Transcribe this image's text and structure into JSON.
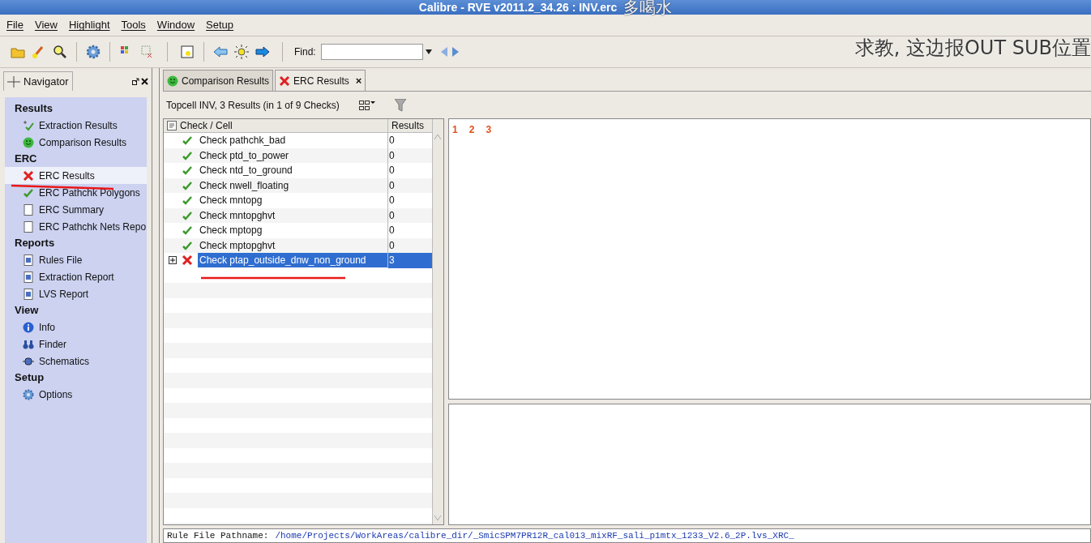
{
  "window": {
    "title": "Calibre - RVE v2011.2_34.26 : INV.erc"
  },
  "menu": [
    "File",
    "View",
    "Highlight",
    "Tools",
    "Window",
    "Setup"
  ],
  "toolbar": {
    "find_label": "Find:"
  },
  "navigator": {
    "tab": "Navigator",
    "sections": [
      {
        "title": "Results",
        "items": [
          {
            "label": "Extraction Results",
            "kind": "extraction",
            "selected": false
          },
          {
            "label": "Comparison Results",
            "kind": "smiley",
            "selected": false
          }
        ]
      },
      {
        "title": "ERC",
        "items": [
          {
            "label": "ERC Results",
            "kind": "cross",
            "selected": true
          },
          {
            "label": "ERC Pathchk Polygons",
            "kind": "check",
            "selected": false
          },
          {
            "label": "ERC Summary",
            "kind": "page",
            "selected": false
          },
          {
            "label": "ERC Pathchk Nets Repo",
            "kind": "page",
            "selected": false
          }
        ]
      },
      {
        "title": "Reports",
        "items": [
          {
            "label": "Rules File",
            "kind": "rules",
            "selected": false
          },
          {
            "label": "Extraction Report",
            "kind": "report",
            "selected": false
          },
          {
            "label": "LVS Report",
            "kind": "lvs",
            "selected": false
          }
        ]
      },
      {
        "title": "View",
        "items": [
          {
            "label": "Info",
            "kind": "info",
            "selected": false
          },
          {
            "label": "Finder",
            "kind": "binoculars",
            "selected": false
          },
          {
            "label": "Schematics",
            "kind": "plug",
            "selected": false
          }
        ]
      },
      {
        "title": "Setup",
        "items": [
          {
            "label": "Options",
            "kind": "gear",
            "selected": false
          }
        ]
      }
    ]
  },
  "tabs": [
    {
      "label": "Comparison Results",
      "kind": "smiley",
      "selected": false
    },
    {
      "label": "ERC Results",
      "kind": "cross",
      "selected": true,
      "close": "×"
    }
  ],
  "summary": "Topcell INV, 3 Results (in 1 of 9 Checks)",
  "table": {
    "columns": [
      "Check / Cell",
      "Results"
    ],
    "rows": [
      {
        "name": "Check pathchk_bad",
        "result": "0",
        "failed": false,
        "selected": false
      },
      {
        "name": "Check ptd_to_power",
        "result": "0",
        "failed": false,
        "selected": false
      },
      {
        "name": "Check ntd_to_ground",
        "result": "0",
        "failed": false,
        "selected": false
      },
      {
        "name": "Check nwell_floating",
        "result": "0",
        "failed": false,
        "selected": false
      },
      {
        "name": "Check mntopg",
        "result": "0",
        "failed": false,
        "selected": false
      },
      {
        "name": "Check mntopghvt",
        "result": "0",
        "failed": false,
        "selected": false
      },
      {
        "name": "Check mptopg",
        "result": "0",
        "failed": false,
        "selected": false
      },
      {
        "name": "Check mptopghvt",
        "result": "0",
        "failed": false,
        "selected": false
      },
      {
        "name": "Check ptap_outside_dnw_non_ground",
        "result": "3",
        "failed": true,
        "selected": true,
        "expanded": false
      }
    ]
  },
  "result_ids": [
    "1",
    "2",
    "3"
  ],
  "status_line": {
    "label": "Rule File Pathname:",
    "value": "/home/Projects/WorkAreas/calibre_dir/_SmicSPM7PR12R_cal013_mixRF_sali_p1mtx_1233_V2.6_2P.lvs_XRC_"
  },
  "overlay": {
    "title_note": "多喝水",
    "caption": "求教, 这边报OUT SUB位置"
  }
}
